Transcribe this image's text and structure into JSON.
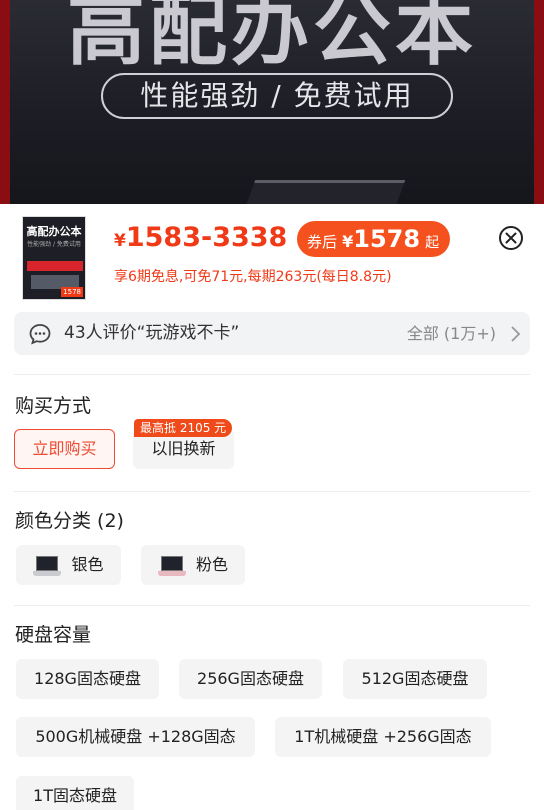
{
  "banner": {
    "title": "高配办公本",
    "pill": "性能强劲 / 免费试用"
  },
  "product": {
    "thumbnail": {
      "title": "高配办公本",
      "subtitle": "性能强劲 / 免费试用",
      "price": "1578"
    },
    "price_symbol": "¥",
    "price_range": "1583-3338",
    "coupon": {
      "label": "券后",
      "symbol": "¥",
      "price": "1578",
      "suffix": "起"
    },
    "installment": "享6期免息,可免71元,每期263元(每日8.8元)"
  },
  "review": {
    "text": "43人评价“玩游戏不卡”",
    "all": "全部 (1万+)"
  },
  "purchase": {
    "title": "购买方式",
    "options": [
      "立即购买",
      "以旧换新"
    ],
    "badge": "最高抵 2105 元",
    "selected": "立即购买"
  },
  "color": {
    "title": "颜色分类 (2)",
    "options": [
      "银色",
      "粉色"
    ],
    "swatches": [
      "#c9cbd0",
      "#e9b9c2"
    ]
  },
  "storage": {
    "title": "硬盘容量",
    "options": [
      "128G固态硬盘",
      "256G固态硬盘",
      "512G固态硬盘",
      "500G机械硬盘 +128G固态",
      "1T机械硬盘 +256G固态",
      "1T固态硬盘"
    ]
  },
  "colors": {
    "accent": "#f03a17",
    "coupon": "#f4511e",
    "banner_frame": "#8a0d14"
  },
  "icons": {
    "close": "close-circle-icon",
    "review": "chat-bubble-icon",
    "chevron": "chevron-right-icon"
  }
}
